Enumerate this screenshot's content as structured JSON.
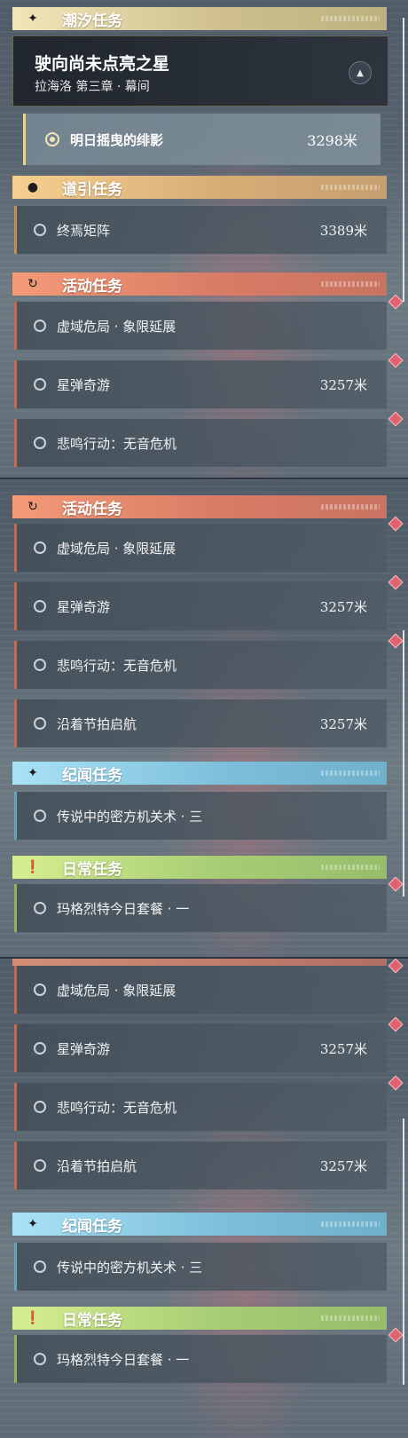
{
  "sections": {
    "tidal": {
      "title": "潮汐任务",
      "icon": "sparkle-icon"
    },
    "guide": {
      "title": "道引任务",
      "icon": "location-pin-icon"
    },
    "event": {
      "title": "活动任务",
      "icon": "refresh-arrow-icon"
    },
    "legend": {
      "title": "纪闻任务",
      "icon": "sparkle-icon"
    },
    "daily": {
      "title": "日常任务",
      "icon": "exclamation-box-icon"
    }
  },
  "main_quest": {
    "title": "驶向尚未点亮之星",
    "subtitle": "拉海洛 第三章 · 幕间",
    "step": {
      "label": "明日摇曳的绯影",
      "distance": "3298米"
    }
  },
  "guide_quest": {
    "label": "终焉矩阵",
    "distance": "3389米"
  },
  "event_quests": [
    {
      "label": "虚域危局 · 象限延展",
      "distance": ""
    },
    {
      "label": "星弹奇游",
      "distance": "3257米"
    },
    {
      "label": "悲鸣行动：无音危机",
      "distance": ""
    },
    {
      "label": "沿着节拍启航",
      "distance": "3257米"
    }
  ],
  "legend_quest": {
    "label": "传说中的密方机关术 · 三"
  },
  "daily_quest": {
    "label": "玛格烈特今日套餐 · 一"
  },
  "colors": {
    "tidal": "#e9dcaa",
    "guide": "#eec48b",
    "event": "#ee8f70",
    "legend": "#9bd6ee",
    "daily": "#c8e487",
    "alert_marker": "#e0626f"
  }
}
